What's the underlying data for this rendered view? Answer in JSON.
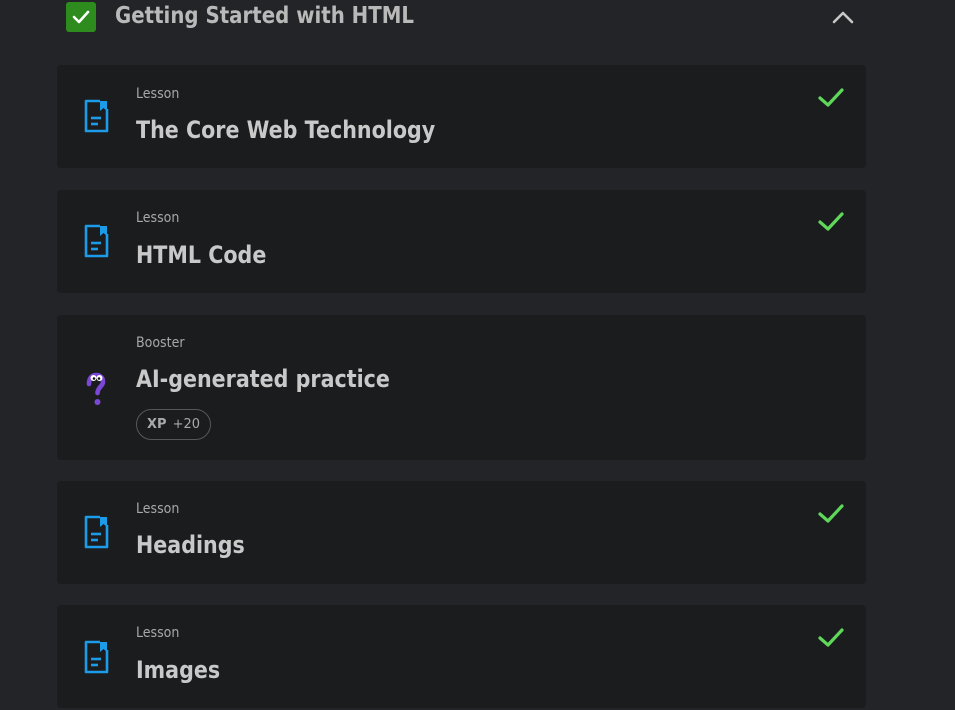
{
  "section": {
    "title": "Getting Started with HTML",
    "completed": true,
    "expanded": true
  },
  "items": [
    {
      "type": "Lesson",
      "title": "The Core Web Technology",
      "icon": "lesson-doc-icon",
      "completed": true
    },
    {
      "type": "Lesson",
      "title": "HTML Code",
      "icon": "lesson-doc-icon",
      "completed": true
    },
    {
      "type": "Booster",
      "title": "AI-generated practice",
      "icon": "question-mascot-icon",
      "completed": false,
      "xp_label": "XP",
      "xp_value": "+20"
    },
    {
      "type": "Lesson",
      "title": "Headings",
      "icon": "lesson-doc-icon",
      "completed": true
    },
    {
      "type": "Lesson",
      "title": "Images",
      "icon": "lesson-doc-icon",
      "completed": true
    }
  ],
  "colors": {
    "background": "#232427",
    "card": "#1b1c1e",
    "section_check": "#2e8b1e",
    "done_check": "#5fd85a",
    "lesson_icon": "#1c9be8",
    "booster_icon": "#7b47d6"
  }
}
